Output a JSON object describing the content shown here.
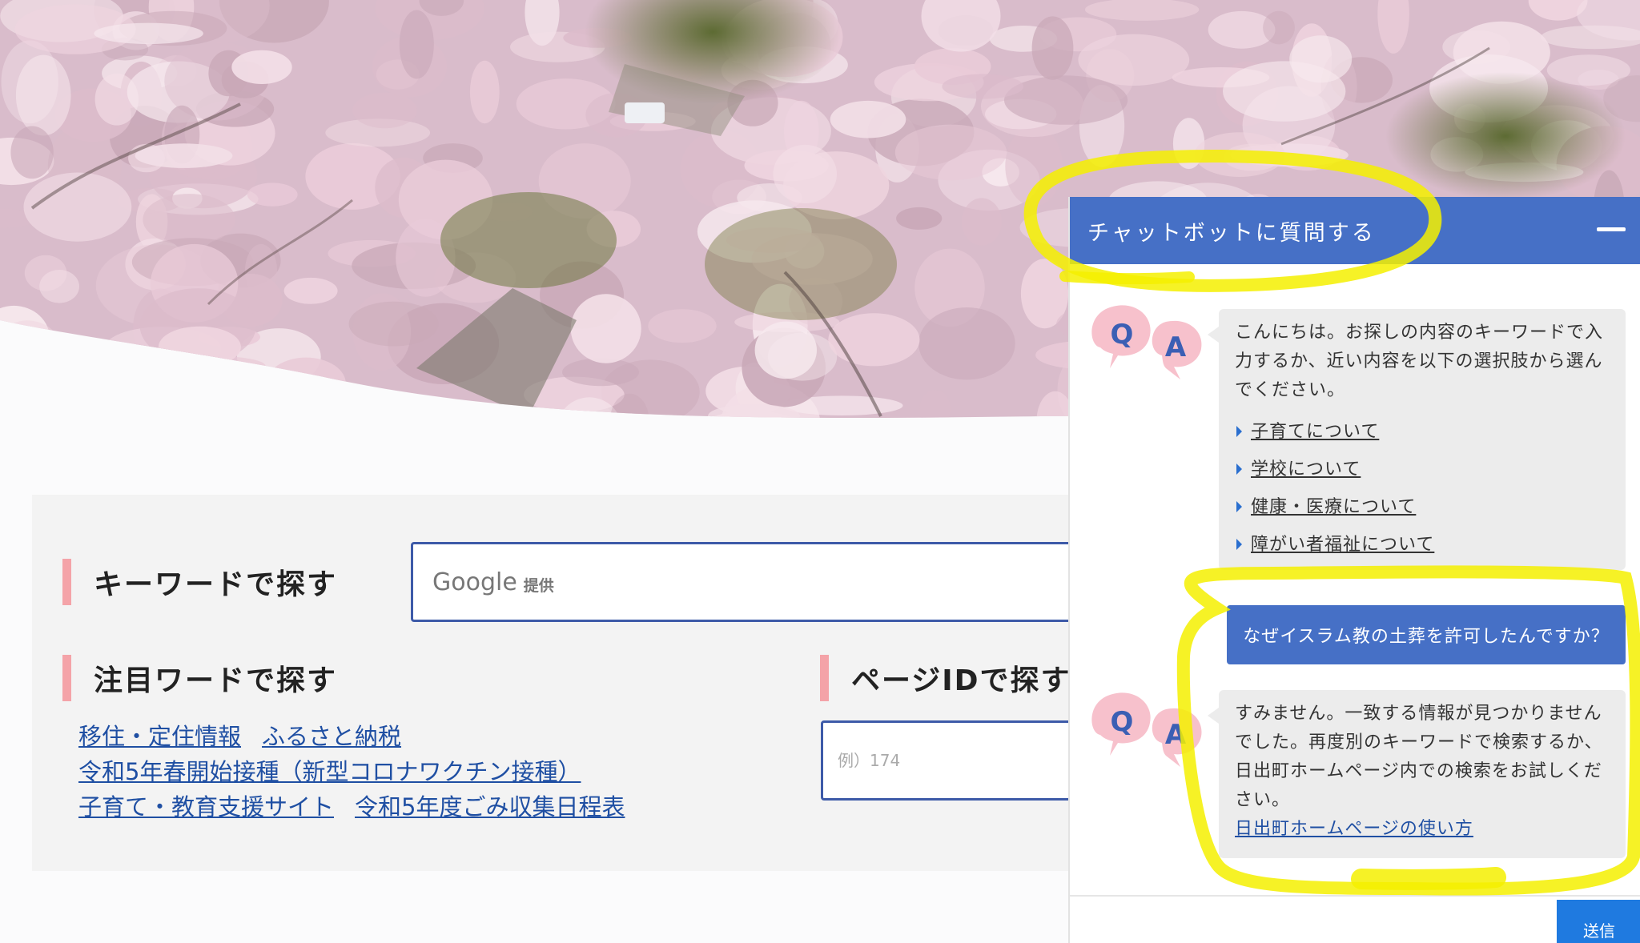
{
  "search": {
    "keyword_heading": "キーワードで探す",
    "google_label": "Google",
    "google_provided": "提供"
  },
  "featured": {
    "heading": "注目ワードで探す",
    "links": [
      "移住・定住情報",
      "ふるさと納税",
      "令和5年春開始接種（新型コロナワクチン接種）",
      "子育て・教育支援サイト",
      "令和5年度ごみ収集日程表"
    ]
  },
  "page_id": {
    "heading": "ページIDで探す",
    "placeholder": "例）174"
  },
  "chatbot": {
    "title": "チャットボットに質問する",
    "greeting": "こんにちは。お探しの内容のキーワードで入力するか、近い内容を以下の選択肢から選んでください。",
    "choices": [
      "子育てについて",
      "学校について",
      "健康・医療について",
      "障がい者福祉について"
    ],
    "user_question": "なぜイスラム教の土葬を許可したんですか？",
    "reply": "すみません。一致する情報が見つかりませんでした。再度別のキーワードで検索するか、日出町ホームページ内での検索をお試しください。",
    "reply_link": "日出町ホームページの使い方",
    "send_label": "送信",
    "avatar_q": "Q",
    "avatar_a": "A"
  },
  "colors": {
    "accent_blue": "#4670c6",
    "link_blue": "#1f4fa3",
    "pink_marker": "#f4a3a8",
    "highlighter": "#f4f000"
  }
}
